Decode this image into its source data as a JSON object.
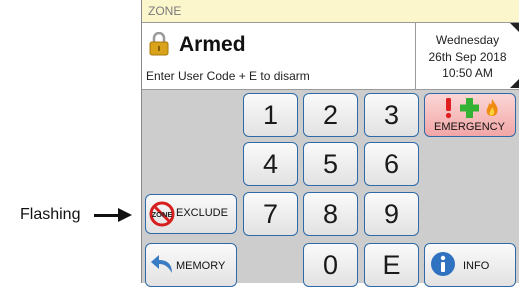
{
  "header": {
    "zone_label": "ZONE"
  },
  "status": {
    "state": "Armed",
    "instruction": "Enter User Code + E to disarm"
  },
  "datetime": {
    "day": "Wednesday",
    "date": "26th Sep 2018",
    "time": "10:50 AM"
  },
  "keypad": {
    "k1": "1",
    "k2": "2",
    "k3": "3",
    "k4": "4",
    "k5": "5",
    "k6": "6",
    "k7": "7",
    "k8": "8",
    "k9": "9",
    "k0": "0",
    "kE": "E"
  },
  "buttons": {
    "emergency": "EMERGENCY",
    "exclude": "EXCLUDE",
    "exclude_icon_text": "ZONE",
    "memory": "MEMORY",
    "info": "INFO"
  },
  "annotation": {
    "label": "Flashing"
  },
  "colors": {
    "panel_bg": "#cdcdcd",
    "zone_bar": "#fbf6cc",
    "button_border": "#2e6aa8",
    "emergency_bg": "#f2a6a6",
    "lock_gold": "#d9a21b",
    "no_symbol_red": "#d62020"
  }
}
